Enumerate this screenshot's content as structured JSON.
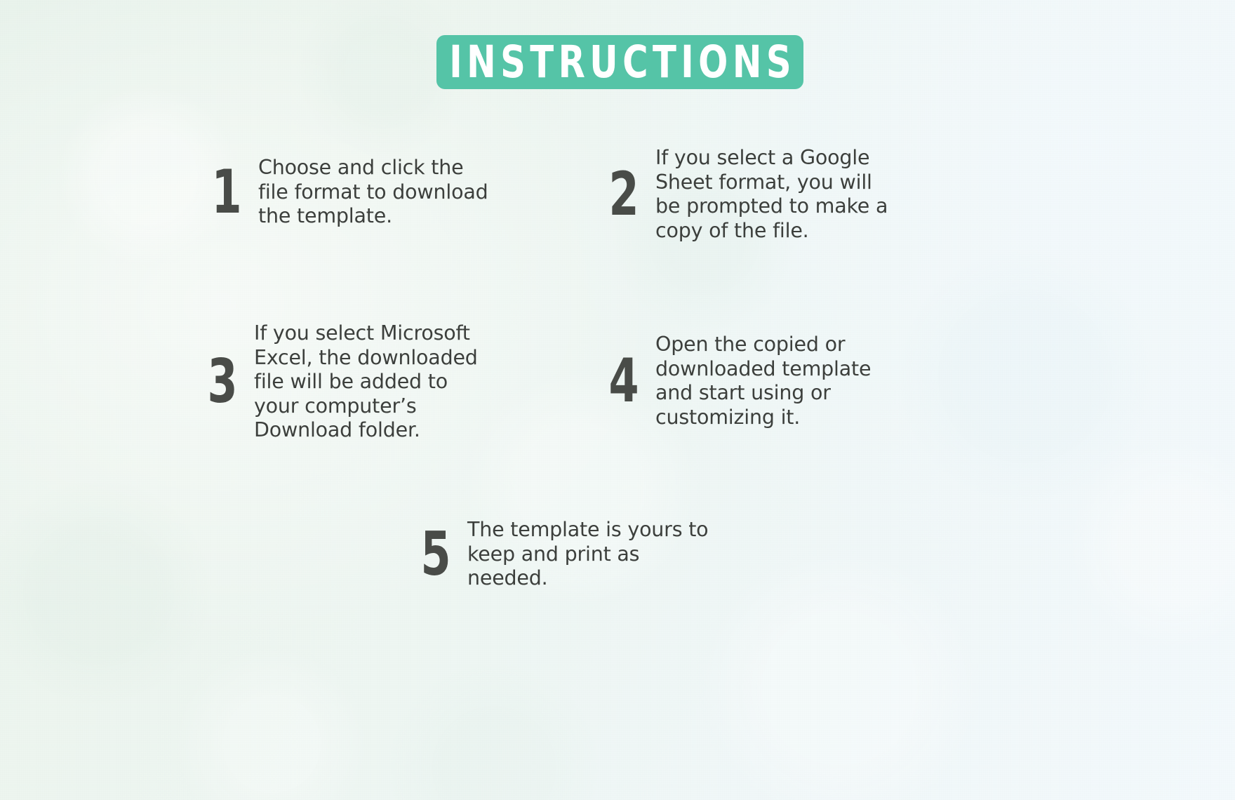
{
  "colors": {
    "banner_fill": "#55c4a7",
    "banner_text": "#ffffff",
    "number_color": "#494c48",
    "body_text": "#3c3f3c",
    "background_left": "#e9f3ec",
    "background_right": "#f3f9fc"
  },
  "header": {
    "title": "INSTRUCTIONS"
  },
  "steps": [
    {
      "number": "1",
      "text": "Choose and click the\nfile format to download\nthe template."
    },
    {
      "number": "2",
      "text": "If you select a Google\nSheet format, you will\nbe prompted to make a\ncopy of the file."
    },
    {
      "number": "3",
      "text": "If you select Microsoft\nExcel, the downloaded\nfile will be added to\nyour computer’s\nDownload  folder."
    },
    {
      "number": "4",
      "text": "Open the copied or\ndownloaded template\nand start using or\ncustomizing it."
    },
    {
      "number": "5",
      "text": "The template is yours to\nkeep and print as\nneeded."
    }
  ]
}
